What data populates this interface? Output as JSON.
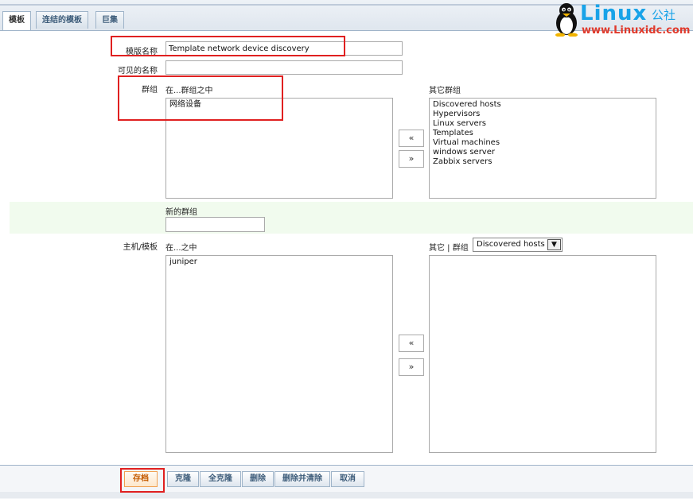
{
  "tabs": [
    {
      "label": "模板",
      "active": true
    },
    {
      "label": "连结的模板",
      "active": false
    },
    {
      "label": "巨集",
      "active": false
    }
  ],
  "logo": {
    "word": "Linux",
    "cn": "公社",
    "url": "www.Linuxidc.com"
  },
  "form": {
    "template_name_label": "模版名称",
    "template_name_value": "Template network device discovery",
    "visible_name_label": "可见的名称",
    "visible_name_value": "",
    "groups_label": "群组",
    "groups_in_label": "在...群组之中",
    "groups_in": [
      "网络设备"
    ],
    "groups_other_label": "其它群组",
    "groups_other": [
      "Discovered hosts",
      "Hypervisors",
      "Linux servers",
      "Templates",
      "Virtual machines",
      "windows server",
      "Zabbix servers"
    ],
    "new_group_label": "新的群组",
    "new_group_value": "",
    "hosts_label": "主机/模板",
    "hosts_in_label": "在...之中",
    "hosts_in": [
      "juniper"
    ],
    "hosts_other_label": "其它 | 群组",
    "hosts_other_group_selected": "Discovered hosts",
    "hosts_other": [],
    "move_left": "«",
    "move_right": "»"
  },
  "footer": {
    "save": "存档",
    "clone": "克隆",
    "full_clone": "全克隆",
    "delete": "删除",
    "delete_clear": "删除并清除",
    "cancel": "取消"
  },
  "colors": {
    "highlight": "#e02020",
    "brand": "#19a3e8",
    "link": "#3d5c7a"
  }
}
